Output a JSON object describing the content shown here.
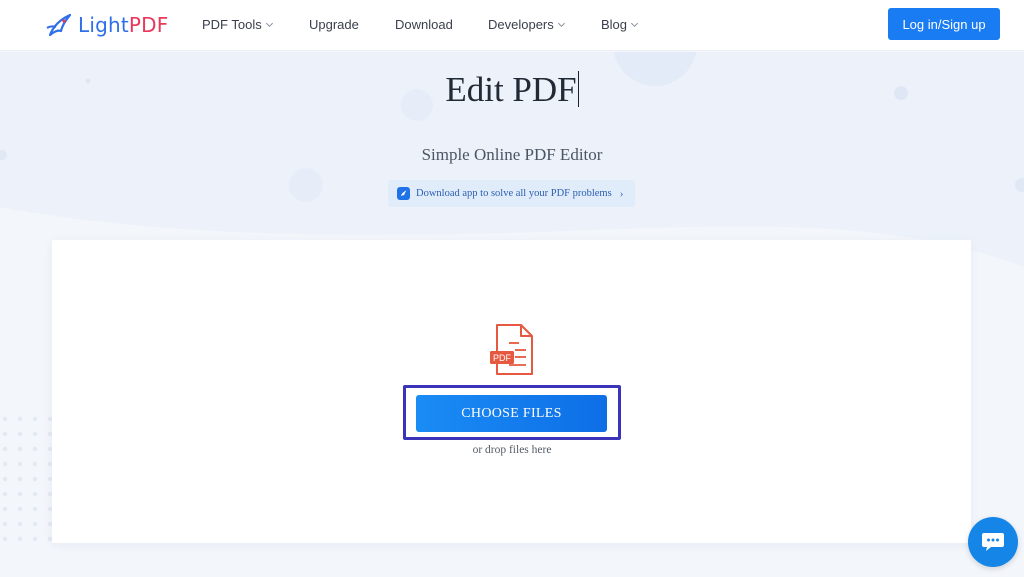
{
  "brand": {
    "name_part1": "Light",
    "name_part2": "PDF",
    "colors": {
      "light": "#2f6fe8",
      "pdf": "#e9385b"
    }
  },
  "nav": {
    "items": [
      {
        "label": "PDF Tools",
        "has_dropdown": true
      },
      {
        "label": "Upgrade",
        "has_dropdown": false
      },
      {
        "label": "Download",
        "has_dropdown": false
      },
      {
        "label": "Developers",
        "has_dropdown": true
      },
      {
        "label": "Blog",
        "has_dropdown": true
      }
    ],
    "login_label": "Log in/Sign up"
  },
  "hero": {
    "title": "Edit PDF",
    "subtitle": "Simple Online PDF Editor",
    "app_banner": "Download app to solve all your PDF problems"
  },
  "upload": {
    "file_icon_label": "PDF",
    "choose_label": "CHOOSE FILES",
    "drop_hint": "or drop files here"
  },
  "icons": {
    "logo": "lightpdf-logo-icon",
    "chevron": "chevron-down-icon",
    "banner": "app-icon",
    "file": "pdf-file-icon",
    "chat": "chat-icon"
  },
  "colors": {
    "accent": "#1a7cf2",
    "highlight_outline": "#3b34b8",
    "page_bg": "#f3f6fb"
  }
}
